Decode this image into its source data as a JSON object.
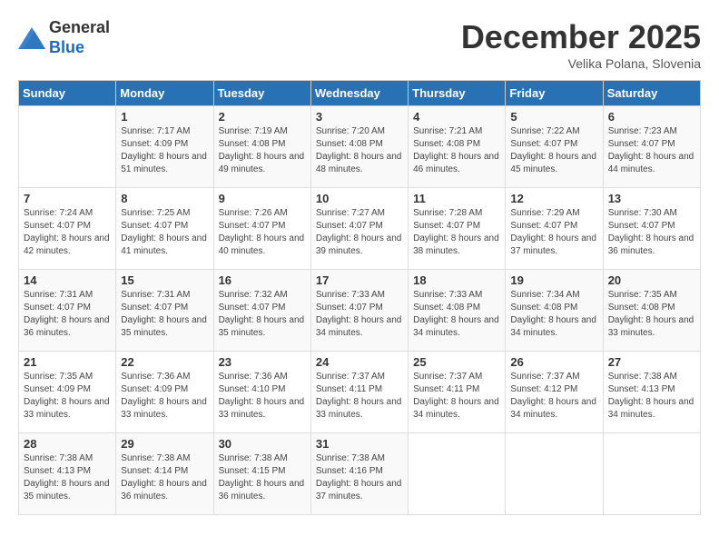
{
  "header": {
    "logo_general": "General",
    "logo_blue": "Blue",
    "month_title": "December 2025",
    "subtitle": "Velika Polana, Slovenia"
  },
  "weekdays": [
    "Sunday",
    "Monday",
    "Tuesday",
    "Wednesday",
    "Thursday",
    "Friday",
    "Saturday"
  ],
  "weeks": [
    [
      {
        "day": "",
        "sunrise": "",
        "sunset": "",
        "daylight": ""
      },
      {
        "day": "1",
        "sunrise": "Sunrise: 7:17 AM",
        "sunset": "Sunset: 4:09 PM",
        "daylight": "Daylight: 8 hours and 51 minutes."
      },
      {
        "day": "2",
        "sunrise": "Sunrise: 7:19 AM",
        "sunset": "Sunset: 4:08 PM",
        "daylight": "Daylight: 8 hours and 49 minutes."
      },
      {
        "day": "3",
        "sunrise": "Sunrise: 7:20 AM",
        "sunset": "Sunset: 4:08 PM",
        "daylight": "Daylight: 8 hours and 48 minutes."
      },
      {
        "day": "4",
        "sunrise": "Sunrise: 7:21 AM",
        "sunset": "Sunset: 4:08 PM",
        "daylight": "Daylight: 8 hours and 46 minutes."
      },
      {
        "day": "5",
        "sunrise": "Sunrise: 7:22 AM",
        "sunset": "Sunset: 4:07 PM",
        "daylight": "Daylight: 8 hours and 45 minutes."
      },
      {
        "day": "6",
        "sunrise": "Sunrise: 7:23 AM",
        "sunset": "Sunset: 4:07 PM",
        "daylight": "Daylight: 8 hours and 44 minutes."
      }
    ],
    [
      {
        "day": "7",
        "sunrise": "Sunrise: 7:24 AM",
        "sunset": "Sunset: 4:07 PM",
        "daylight": "Daylight: 8 hours and 42 minutes."
      },
      {
        "day": "8",
        "sunrise": "Sunrise: 7:25 AM",
        "sunset": "Sunset: 4:07 PM",
        "daylight": "Daylight: 8 hours and 41 minutes."
      },
      {
        "day": "9",
        "sunrise": "Sunrise: 7:26 AM",
        "sunset": "Sunset: 4:07 PM",
        "daylight": "Daylight: 8 hours and 40 minutes."
      },
      {
        "day": "10",
        "sunrise": "Sunrise: 7:27 AM",
        "sunset": "Sunset: 4:07 PM",
        "daylight": "Daylight: 8 hours and 39 minutes."
      },
      {
        "day": "11",
        "sunrise": "Sunrise: 7:28 AM",
        "sunset": "Sunset: 4:07 PM",
        "daylight": "Daylight: 8 hours and 38 minutes."
      },
      {
        "day": "12",
        "sunrise": "Sunrise: 7:29 AM",
        "sunset": "Sunset: 4:07 PM",
        "daylight": "Daylight: 8 hours and 37 minutes."
      },
      {
        "day": "13",
        "sunrise": "Sunrise: 7:30 AM",
        "sunset": "Sunset: 4:07 PM",
        "daylight": "Daylight: 8 hours and 36 minutes."
      }
    ],
    [
      {
        "day": "14",
        "sunrise": "Sunrise: 7:31 AM",
        "sunset": "Sunset: 4:07 PM",
        "daylight": "Daylight: 8 hours and 36 minutes."
      },
      {
        "day": "15",
        "sunrise": "Sunrise: 7:31 AM",
        "sunset": "Sunset: 4:07 PM",
        "daylight": "Daylight: 8 hours and 35 minutes."
      },
      {
        "day": "16",
        "sunrise": "Sunrise: 7:32 AM",
        "sunset": "Sunset: 4:07 PM",
        "daylight": "Daylight: 8 hours and 35 minutes."
      },
      {
        "day": "17",
        "sunrise": "Sunrise: 7:33 AM",
        "sunset": "Sunset: 4:07 PM",
        "daylight": "Daylight: 8 hours and 34 minutes."
      },
      {
        "day": "18",
        "sunrise": "Sunrise: 7:33 AM",
        "sunset": "Sunset: 4:08 PM",
        "daylight": "Daylight: 8 hours and 34 minutes."
      },
      {
        "day": "19",
        "sunrise": "Sunrise: 7:34 AM",
        "sunset": "Sunset: 4:08 PM",
        "daylight": "Daylight: 8 hours and 34 minutes."
      },
      {
        "day": "20",
        "sunrise": "Sunrise: 7:35 AM",
        "sunset": "Sunset: 4:08 PM",
        "daylight": "Daylight: 8 hours and 33 minutes."
      }
    ],
    [
      {
        "day": "21",
        "sunrise": "Sunrise: 7:35 AM",
        "sunset": "Sunset: 4:09 PM",
        "daylight": "Daylight: 8 hours and 33 minutes."
      },
      {
        "day": "22",
        "sunrise": "Sunrise: 7:36 AM",
        "sunset": "Sunset: 4:09 PM",
        "daylight": "Daylight: 8 hours and 33 minutes."
      },
      {
        "day": "23",
        "sunrise": "Sunrise: 7:36 AM",
        "sunset": "Sunset: 4:10 PM",
        "daylight": "Daylight: 8 hours and 33 minutes."
      },
      {
        "day": "24",
        "sunrise": "Sunrise: 7:37 AM",
        "sunset": "Sunset: 4:11 PM",
        "daylight": "Daylight: 8 hours and 33 minutes."
      },
      {
        "day": "25",
        "sunrise": "Sunrise: 7:37 AM",
        "sunset": "Sunset: 4:11 PM",
        "daylight": "Daylight: 8 hours and 34 minutes."
      },
      {
        "day": "26",
        "sunrise": "Sunrise: 7:37 AM",
        "sunset": "Sunset: 4:12 PM",
        "daylight": "Daylight: 8 hours and 34 minutes."
      },
      {
        "day": "27",
        "sunrise": "Sunrise: 7:38 AM",
        "sunset": "Sunset: 4:13 PM",
        "daylight": "Daylight: 8 hours and 34 minutes."
      }
    ],
    [
      {
        "day": "28",
        "sunrise": "Sunrise: 7:38 AM",
        "sunset": "Sunset: 4:13 PM",
        "daylight": "Daylight: 8 hours and 35 minutes."
      },
      {
        "day": "29",
        "sunrise": "Sunrise: 7:38 AM",
        "sunset": "Sunset: 4:14 PM",
        "daylight": "Daylight: 8 hours and 36 minutes."
      },
      {
        "day": "30",
        "sunrise": "Sunrise: 7:38 AM",
        "sunset": "Sunset: 4:15 PM",
        "daylight": "Daylight: 8 hours and 36 minutes."
      },
      {
        "day": "31",
        "sunrise": "Sunrise: 7:38 AM",
        "sunset": "Sunset: 4:16 PM",
        "daylight": "Daylight: 8 hours and 37 minutes."
      },
      {
        "day": "",
        "sunrise": "",
        "sunset": "",
        "daylight": ""
      },
      {
        "day": "",
        "sunrise": "",
        "sunset": "",
        "daylight": ""
      },
      {
        "day": "",
        "sunrise": "",
        "sunset": "",
        "daylight": ""
      }
    ]
  ]
}
